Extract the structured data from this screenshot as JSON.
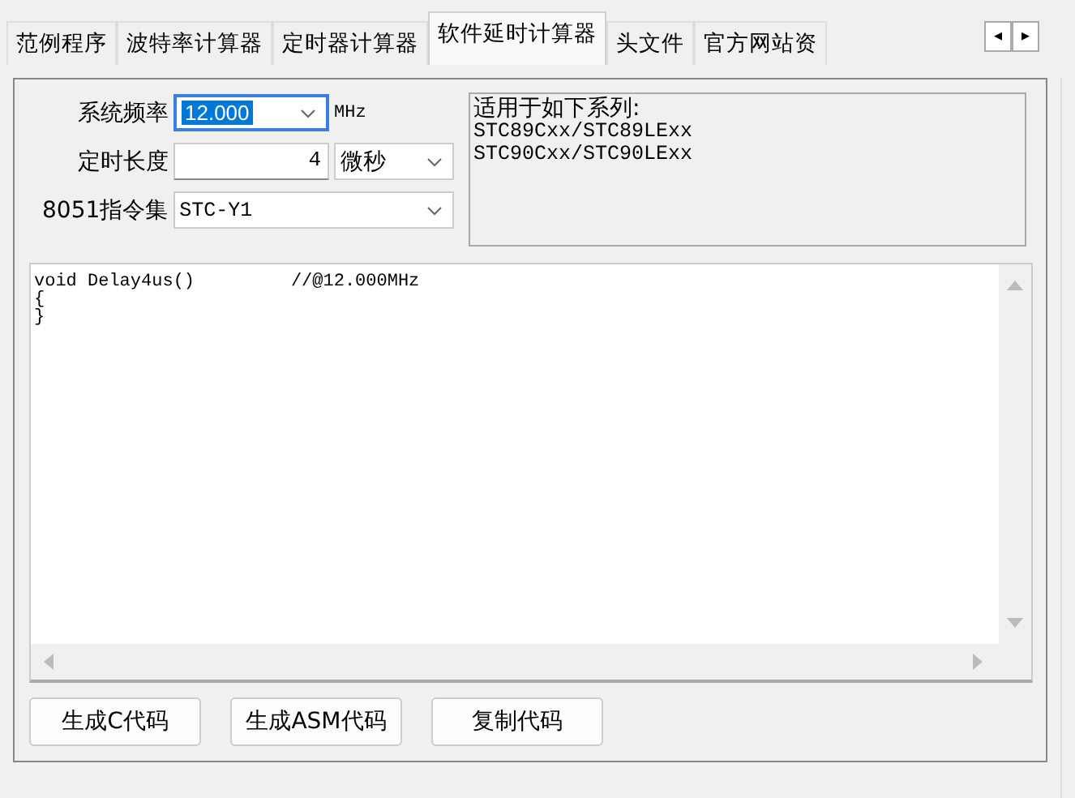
{
  "tabs": [
    {
      "label": "范例程序",
      "selected": false
    },
    {
      "label": "波特率计算器",
      "selected": false
    },
    {
      "label": "定时器计算器",
      "selected": false
    },
    {
      "label": "软件延时计算器",
      "selected": true
    },
    {
      "label": "头文件",
      "selected": false
    },
    {
      "label": "官方网站资",
      "selected": false
    }
  ],
  "tab_scroll": {
    "left": "◂",
    "right": "▸"
  },
  "form": {
    "frequency": {
      "label": "系统频率",
      "value": "12.000",
      "unit": "MHz"
    },
    "duration": {
      "label": "定时长度",
      "value": "4",
      "unit": "微秒"
    },
    "instruction_set": {
      "label": "8051指令集",
      "value": "STC-Y1"
    }
  },
  "applies_to": {
    "title": "适用于如下系列:",
    "lines": [
      "STC89Cxx/STC89LExx",
      "STC90Cxx/STC90LExx"
    ]
  },
  "code": {
    "lines": [
      "void Delay4us()\t\t//@12.000MHz",
      "{",
      "}"
    ]
  },
  "buttons": [
    "生成C代码",
    "生成ASM代码",
    "复制代码"
  ]
}
